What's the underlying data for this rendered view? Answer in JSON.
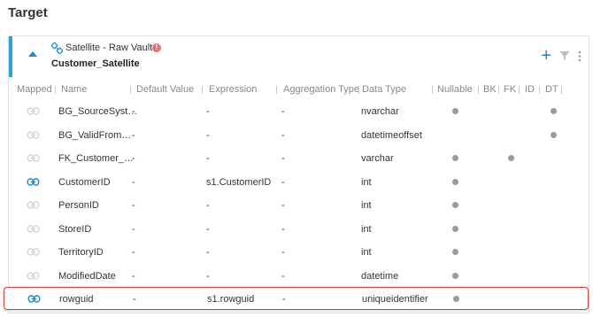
{
  "page": {
    "title": "Target"
  },
  "entity": {
    "type_label": "Satellite - Raw Vault",
    "name": "Customer_Satellite",
    "warning_count": "!",
    "accent_color": "#29a3dd"
  },
  "actions": {
    "add_icon": "plus-icon",
    "filter_icon": "filter-icon",
    "menu_icon": "kebab-menu-icon"
  },
  "columns": [
    "Mapped",
    "Name",
    "Default Value",
    "Expression",
    "Aggregation Type",
    "Data Type",
    "Nullable",
    "BK",
    "FK",
    "ID",
    "DT"
  ],
  "rows": [
    {
      "mapped": false,
      "name": "BG_SourceSyst…",
      "default": "-",
      "expression": "-",
      "aggregation": "-",
      "datatype": "nvarchar",
      "nullable": true,
      "bk": false,
      "fk": false,
      "id": false,
      "dt": true
    },
    {
      "mapped": false,
      "name": "BG_ValidFrom…",
      "default": "-",
      "expression": "-",
      "aggregation": "-",
      "datatype": "datetimeoffset",
      "nullable": false,
      "bk": false,
      "fk": false,
      "id": false,
      "dt": true
    },
    {
      "mapped": false,
      "name": "FK_Customer_…",
      "default": "-",
      "expression": "-",
      "aggregation": "-",
      "datatype": "varchar",
      "nullable": true,
      "bk": false,
      "fk": true,
      "id": false,
      "dt": false
    },
    {
      "mapped": true,
      "name": "CustomerID",
      "default": "-",
      "expression": "s1.CustomerID",
      "aggregation": "-",
      "datatype": "int",
      "nullable": true,
      "bk": false,
      "fk": false,
      "id": false,
      "dt": false
    },
    {
      "mapped": false,
      "name": "PersonID",
      "default": "-",
      "expression": "-",
      "aggregation": "-",
      "datatype": "int",
      "nullable": true,
      "bk": false,
      "fk": false,
      "id": false,
      "dt": false
    },
    {
      "mapped": false,
      "name": "StoreID",
      "default": "-",
      "expression": "-",
      "aggregation": "-",
      "datatype": "int",
      "nullable": true,
      "bk": false,
      "fk": false,
      "id": false,
      "dt": false
    },
    {
      "mapped": false,
      "name": "TerritoryID",
      "default": "-",
      "expression": "-",
      "aggregation": "-",
      "datatype": "int",
      "nullable": true,
      "bk": false,
      "fk": false,
      "id": false,
      "dt": false
    },
    {
      "mapped": false,
      "name": "ModifiedDate",
      "default": "-",
      "expression": "-",
      "aggregation": "-",
      "datatype": "datetime",
      "nullable": true,
      "bk": false,
      "fk": false,
      "id": false,
      "dt": false
    },
    {
      "mapped": true,
      "name": "rowguid",
      "default": "-",
      "expression": "s1.rowguid",
      "aggregation": "-",
      "datatype": "uniqueidentifier",
      "nullable": true,
      "bk": false,
      "fk": false,
      "id": false,
      "dt": false,
      "selected": true
    }
  ],
  "colors": {
    "mapped_link": "#1e88c8",
    "unmapped_link": "#d6d6d6",
    "selected_border": "#e53935",
    "flag_dot": "#9b9b9b"
  }
}
